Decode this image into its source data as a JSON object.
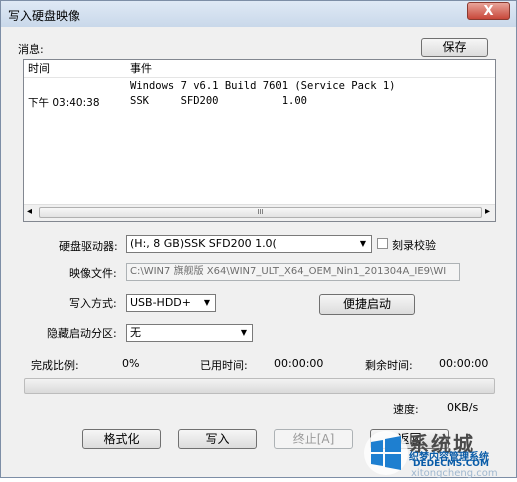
{
  "window": {
    "title": "写入硬盘映像",
    "close_glyph": "X"
  },
  "messages": {
    "label": "消息:",
    "save_button": "保存",
    "columns": [
      "时间",
      "事件"
    ],
    "rows": [
      {
        "time": "",
        "event": "Windows 7 v6.1 Build 7601 (Service Pack 1)"
      },
      {
        "time": "下午 03:40:38",
        "event": "SSK     SFD200          1.00"
      }
    ],
    "scroll_left": "◂",
    "scroll_right": "▸",
    "scroll_thumb": "III"
  },
  "form": {
    "drive_label": "硬盘驱动器:",
    "drive_value": "(H:, 8 GB)SSK      SFD200          1.0(",
    "verify_label": "刻录校验",
    "image_label": "映像文件:",
    "image_value": "C:\\WIN7 旗舰版 X64\\WIN7_ULT_X64_OEM_Nin1_201304A_IE9\\WI",
    "write_mode_label": "写入方式:",
    "write_mode_value": "USB-HDD+",
    "quick_boot_button": "便捷启动",
    "hidden_partition_label": "隐藏启动分区:",
    "hidden_partition_value": "无"
  },
  "status": {
    "completion_label": "完成比例:",
    "completion_value": "0%",
    "elapsed_label": "已用时间:",
    "elapsed_value": "00:00:00",
    "remaining_label": "剩余时间:",
    "remaining_value": "00:00:00",
    "progress_fraction": 0,
    "speed_label": "速度:",
    "speed_value": "0KB/s"
  },
  "buttons": {
    "format": "格式化",
    "write": "写入",
    "stop": "终止[A]",
    "back": "返回"
  },
  "watermark": {
    "text_top": "系统城",
    "text_mid": "织梦内容管理系统",
    "text_site": "DEDECMS.COM",
    "text_url": "xitongcheng.com"
  },
  "colors": {
    "accent_blue": "#1e7fd0",
    "titlebar": "#c9d8ea",
    "close_red": "#c8473a"
  }
}
